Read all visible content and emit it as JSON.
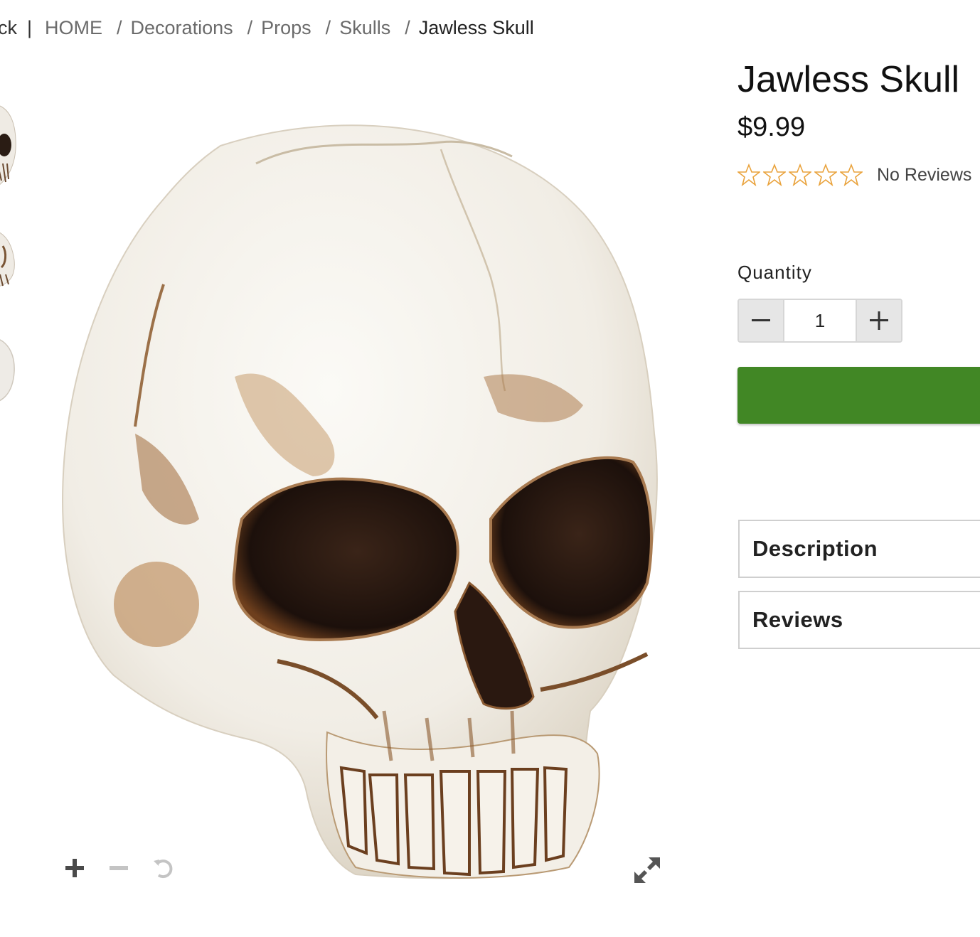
{
  "breadcrumb": {
    "back_label": "ck",
    "items": [
      {
        "label": "HOME"
      },
      {
        "label": "Decorations"
      },
      {
        "label": "Props"
      },
      {
        "label": "Skulls"
      }
    ],
    "current": "Jawless Skull"
  },
  "gallery": {
    "thumbnail_count": 3,
    "zoom_in_icon": "plus-icon",
    "zoom_out_icon": "minus-icon",
    "reset_icon": "rotate-reset-icon",
    "expand_icon": "expand-icon"
  },
  "product": {
    "title": "Jawless Skull",
    "price": "$9.99",
    "rating": 0,
    "rating_max": 5,
    "reviews_label": "No Reviews"
  },
  "purchase": {
    "quantity_label": "Quantity",
    "quantity_value": "1",
    "add_button_color": "#418725",
    "star_color": "#e9a23b"
  },
  "tabs": {
    "description": "Description",
    "reviews": "Reviews"
  }
}
